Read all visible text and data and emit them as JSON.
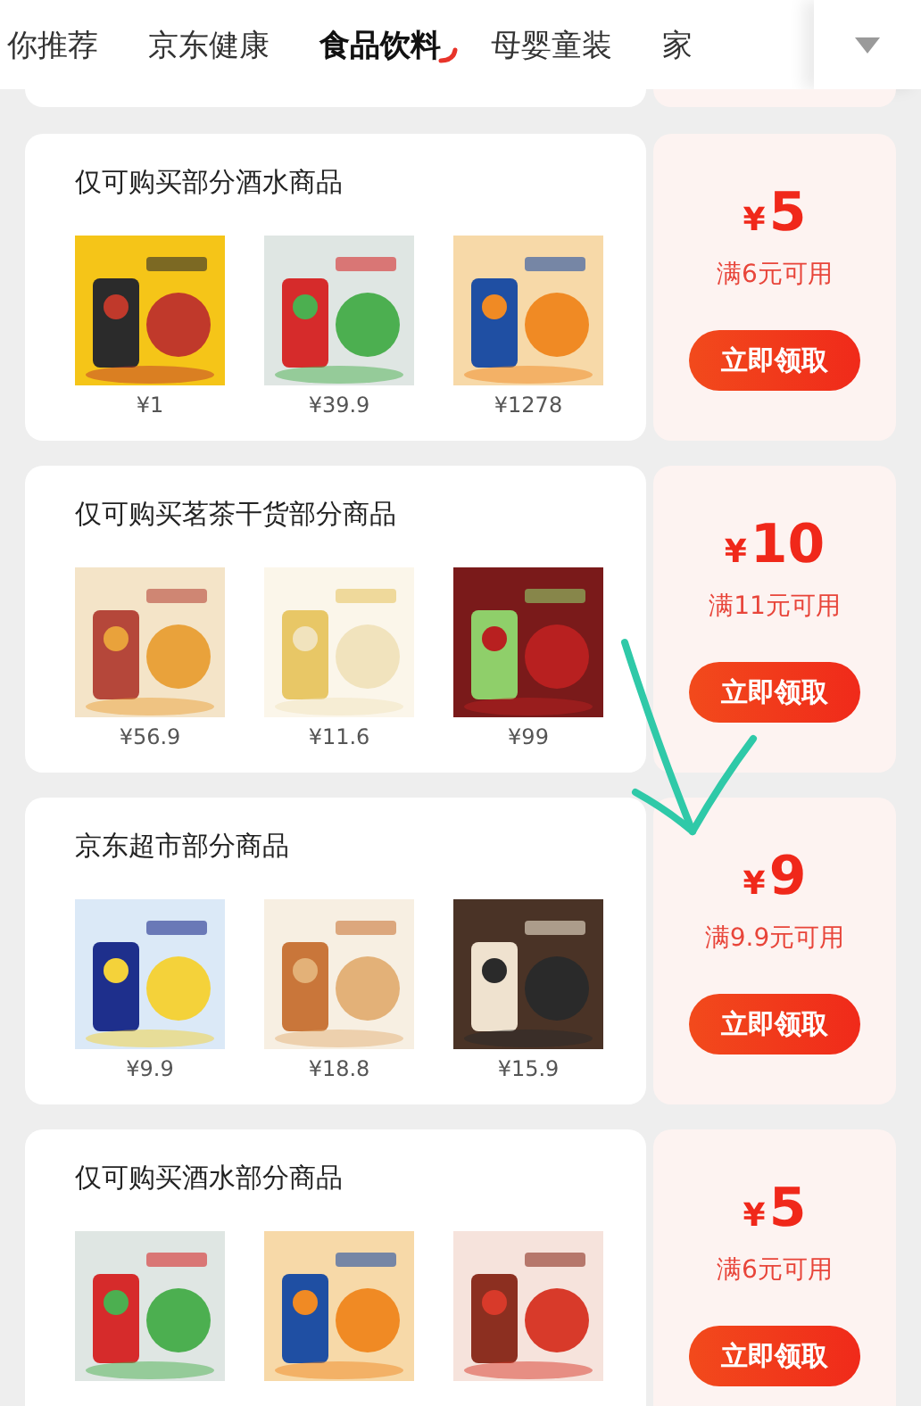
{
  "tabs": [
    {
      "label": "你推荐",
      "selected": false
    },
    {
      "label": "京东健康",
      "selected": false
    },
    {
      "label": "食品饮料",
      "selected": true
    },
    {
      "label": "母婴童装",
      "selected": false
    },
    {
      "label": "家",
      "selected": false
    }
  ],
  "coupons": [
    {
      "title": "仅可购买部分酒水商品",
      "amount": "5",
      "condition": "满6元可用",
      "button": "立即领取",
      "products": [
        {
          "kind": "picture",
          "price": "¥1"
        },
        {
          "kind": "picture",
          "price": "¥39.9"
        },
        {
          "kind": "picture",
          "price": "¥1278"
        }
      ]
    },
    {
      "title": "仅可购买茗茶干货部分商品",
      "amount": "10",
      "condition": "满11元可用",
      "button": "立即领取",
      "products": [
        {
          "kind": "picture",
          "price": "¥56.9"
        },
        {
          "kind": "picture",
          "price": "¥11.6"
        },
        {
          "kind": "picture",
          "price": "¥99"
        }
      ]
    },
    {
      "title": "京东超市部分商品",
      "amount": "9",
      "condition": "满9.9元可用",
      "button": "立即领取",
      "products": [
        {
          "kind": "picture",
          "price": "¥9.9"
        },
        {
          "kind": "picture",
          "price": "¥18.8"
        },
        {
          "kind": "picture",
          "price": "¥15.9"
        }
      ]
    },
    {
      "title": "仅可购买酒水部分商品",
      "amount": "5",
      "condition": "满6元可用",
      "button": "立即领取"
    }
  ],
  "currency": "¥"
}
